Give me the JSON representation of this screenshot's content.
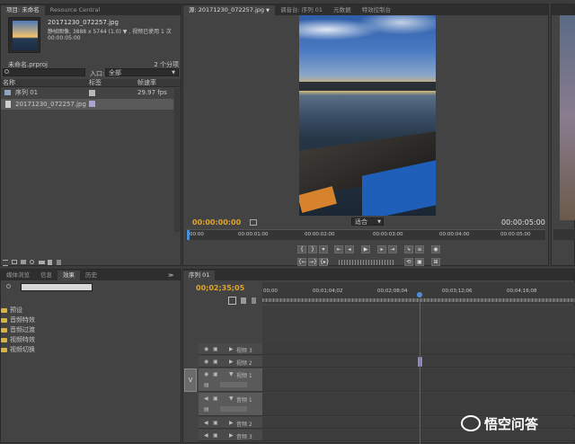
{
  "project_panel": {
    "tabs": [
      "项目: 未命名",
      "Resource Central"
    ],
    "file_name": "20171230_072257.jpg",
    "file_info": "静帧图像, 3888 x 5744 (1.0)  ▼ , 视频已使用 1 次",
    "file_duration": "00:00:05:00",
    "project_file": "未命名.prproj",
    "item_count": "2 个分项",
    "entry_label": "入口:",
    "entry_value": "全部",
    "columns": [
      "名称",
      "标签",
      "帧速率"
    ],
    "items": [
      {
        "name": "序列 01",
        "framerate": "29.97 fps",
        "icon": "sequence-icon",
        "label_color": "#b8b8b8"
      },
      {
        "name": "20171230_072257.jpg",
        "framerate": "",
        "icon": "image-file-icon",
        "label_color": "#a9a3d0"
      }
    ]
  },
  "monitor_panel": {
    "tabs": [
      "源: 20171230_072257.jpg",
      "调音台: 序列 01",
      "元数据",
      "特效控制台"
    ],
    "current_time": "00:00:00:00",
    "fit_value": "适合",
    "duration": "00:00:05:00",
    "ruler_marks": [
      "00:00",
      "00:00:01:00",
      "00:00:02:00",
      "00:00:03:00",
      "00:00:04:00",
      "00:00:05:00"
    ]
  },
  "effects_panel": {
    "tabs": [
      "媒体浏览",
      "信息",
      "效果",
      "历史"
    ],
    "folders": [
      "预设",
      "音频特效",
      "音频过渡",
      "视频特效",
      "视频切换"
    ]
  },
  "timeline_panel": {
    "tab": "序列 01",
    "timecode": "00;02;35;05",
    "ruler_marks": [
      "00;00",
      "00;01;04;02",
      "00;02;08;04",
      "00;03;12;06",
      "00;04;16;08"
    ],
    "video_tracks": [
      "视频 3",
      "视频 2",
      "视频 1"
    ],
    "audio_tracks": [
      "音频 1",
      "音频 2",
      "音频 3"
    ],
    "video_marker": "V"
  },
  "watermark": "悟空问答",
  "colors": {
    "timecode": "#e0a52e",
    "accent": "#4a90d9",
    "playhead": "#c23a3a"
  }
}
